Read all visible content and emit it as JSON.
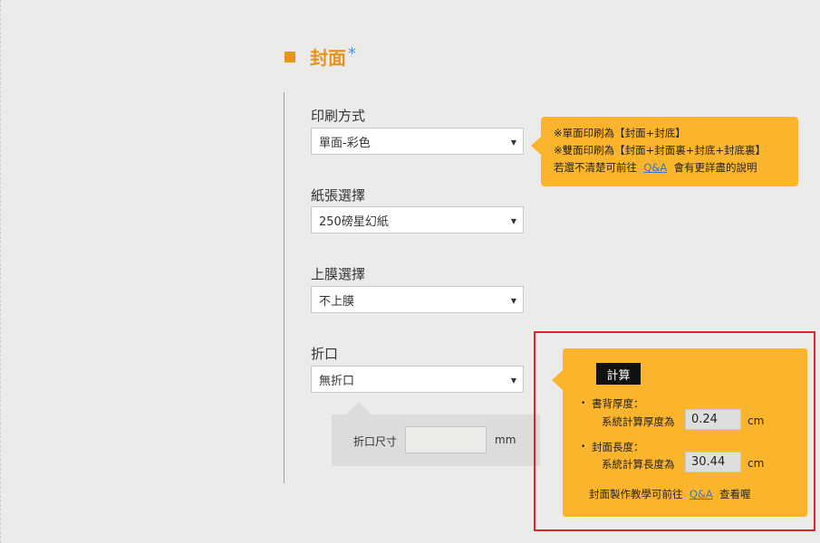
{
  "section": {
    "title": "封面",
    "required_mark": "*"
  },
  "fields": {
    "print_method": {
      "label": "印刷方式",
      "value": "單面-彩色"
    },
    "paper": {
      "label": "紙張選擇",
      "value": "250磅星幻紙"
    },
    "lamination": {
      "label": "上膜選擇",
      "value": "不上膜"
    },
    "fold": {
      "label": "折口",
      "value": "無折口"
    }
  },
  "tip": {
    "line1": "※單面印刷為【封面+封底】",
    "line2": "※雙面印刷為【封面+封面裏+封底+封底裏】",
    "line3_prefix": "若還不清楚可前往",
    "line3_link": "Q&A",
    "line3_suffix": "會有更詳盡的說明"
  },
  "fold_size": {
    "label": "折口尺寸",
    "value": "",
    "unit": "mm"
  },
  "calc": {
    "button": "計算",
    "bullet": "•",
    "spine": {
      "heading": "書背厚度：",
      "desc": "系統計算厚度為",
      "value": "0.24",
      "unit": "cm"
    },
    "cover": {
      "heading": "封面長度：",
      "desc": "系統計算長度為",
      "value": "30.44",
      "unit": "cm"
    },
    "footer_prefix": "封面製作教學可前往",
    "footer_link": "Q&A",
    "footer_suffix": "查看喔"
  },
  "icons": {
    "dropdown_arrow": "▼"
  },
  "colors": {
    "accent": "#e8941a",
    "tip_bg": "#fbb52c",
    "highlight": "#e0222c",
    "link": "#3a78c2"
  }
}
